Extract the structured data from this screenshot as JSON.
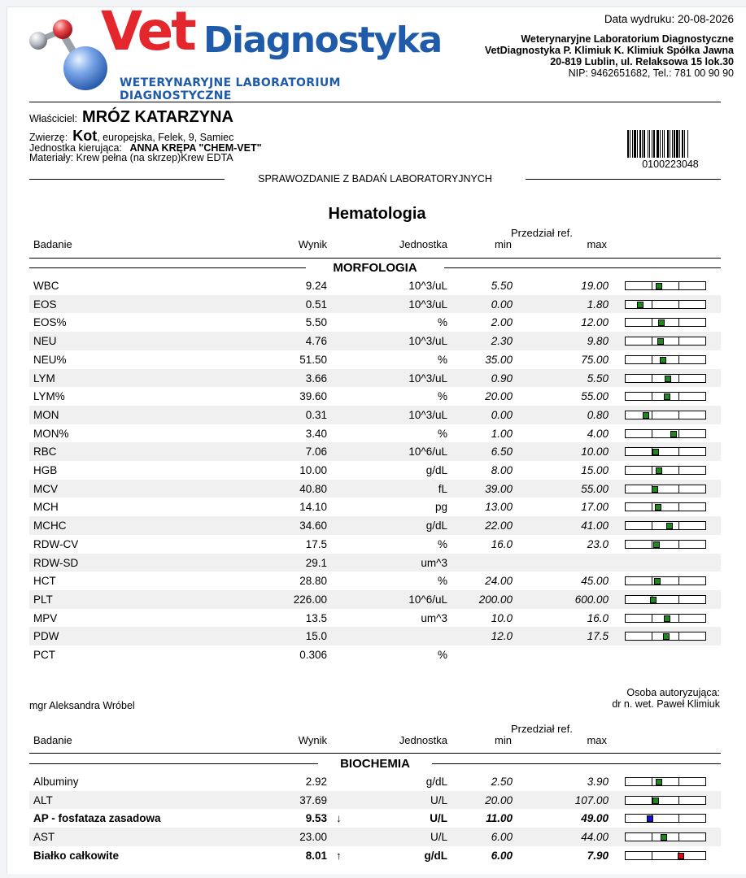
{
  "header": {
    "logo_vet": "Vet",
    "logo_diag": "Diagnostyka",
    "logo_sub": "WETERYNARYJNE LABORATORIUM DIAGNOSTYCZNE",
    "print_date": "Data wydruku: 20-08-2026",
    "lab_line1": "Weterynaryjne Laboratorium Diagnostyczne",
    "lab_line2": "VetDiagnostyka P. Klimiuk K. Klimiuk Spółka Jawna",
    "lab_line3": "20-819 Lublin, ul. Relaksowa 15 lok.30",
    "lab_line4": "NIP: 9462651682, Tel.: 781 00 90 90"
  },
  "patient": {
    "owner_label": "Właściciel:",
    "owner_name": "MRÓZ KATARZYNA",
    "animal_label": "Zwierzę:",
    "species": "Kot",
    "animal_details": ", europejska, Felek, 9, Samiec",
    "unit_label": "Jednostka kierująca:",
    "unit_value": "ANNA KRĘPA \"CHEM-VET\"",
    "materials_label": "Materiały:",
    "materials_value": "Krew pełna (na skrzep)Krew EDTA",
    "barcode_number": "0100223048"
  },
  "report_title": "SPRAWOZDANIE Z BADAŃ LABORATORYJNYCH",
  "columns": {
    "badanie": "Badanie",
    "wynik": "Wynik",
    "jednostka": "Jednostka",
    "ref": "Przedział ref.",
    "min": "min",
    "max": "max"
  },
  "hematology": {
    "title": "Hematologia",
    "group": "MORFOLOGIA",
    "rows": [
      {
        "name": "WBC",
        "result": "9.24",
        "arrow": "",
        "unit": "10^3/uL",
        "min": "5.50",
        "max": "19.00",
        "bold": false,
        "marker_pos": 0.42,
        "marker_color": "#1a8a1a"
      },
      {
        "name": "EOS",
        "result": "0.51",
        "arrow": "",
        "unit": "10^3/uL",
        "min": "0.00",
        "max": "1.80",
        "bold": false,
        "marker_pos": 0.18,
        "marker_color": "#1a8a1a"
      },
      {
        "name": "EOS%",
        "result": "5.50",
        "arrow": "",
        "unit": "%",
        "min": "2.00",
        "max": "12.00",
        "bold": false,
        "marker_pos": 0.45,
        "marker_color": "#1a8a1a"
      },
      {
        "name": "NEU",
        "result": "4.76",
        "arrow": "",
        "unit": "10^3/uL",
        "min": "2.30",
        "max": "9.80",
        "bold": false,
        "marker_pos": 0.44,
        "marker_color": "#1a8a1a"
      },
      {
        "name": "NEU%",
        "result": "51.50",
        "arrow": "",
        "unit": "%",
        "min": "35.00",
        "max": "75.00",
        "bold": false,
        "marker_pos": 0.47,
        "marker_color": "#1a8a1a"
      },
      {
        "name": "LYM",
        "result": "3.66",
        "arrow": "",
        "unit": "10^3/uL",
        "min": "0.90",
        "max": "5.50",
        "bold": false,
        "marker_pos": 0.53,
        "marker_color": "#1a8a1a"
      },
      {
        "name": "LYM%",
        "result": "39.60",
        "arrow": "",
        "unit": "%",
        "min": "20.00",
        "max": "55.00",
        "bold": false,
        "marker_pos": 0.52,
        "marker_color": "#1a8a1a"
      },
      {
        "name": "MON",
        "result": "0.31",
        "arrow": "",
        "unit": "10^3/uL",
        "min": "0.00",
        "max": "0.80",
        "bold": false,
        "marker_pos": 0.25,
        "marker_color": "#1a8a1a"
      },
      {
        "name": "MON%",
        "result": "3.40",
        "arrow": "",
        "unit": "%",
        "min": "1.00",
        "max": "4.00",
        "bold": false,
        "marker_pos": 0.6,
        "marker_color": "#1a8a1a"
      },
      {
        "name": "RBC",
        "result": "7.06",
        "arrow": "",
        "unit": "10^6/uL",
        "min": "6.50",
        "max": "10.00",
        "bold": false,
        "marker_pos": 0.38,
        "marker_color": "#1a8a1a"
      },
      {
        "name": "HGB",
        "result": "10.00",
        "arrow": "",
        "unit": "g/dL",
        "min": "8.00",
        "max": "15.00",
        "bold": false,
        "marker_pos": 0.42,
        "marker_color": "#1a8a1a"
      },
      {
        "name": "MCV",
        "result": "40.80",
        "arrow": "",
        "unit": "fL",
        "min": "39.00",
        "max": "55.00",
        "bold": false,
        "marker_pos": 0.37,
        "marker_color": "#1a8a1a"
      },
      {
        "name": "MCH",
        "result": "14.10",
        "arrow": "",
        "unit": "pg",
        "min": "13.00",
        "max": "17.00",
        "bold": false,
        "marker_pos": 0.41,
        "marker_color": "#1a8a1a"
      },
      {
        "name": "MCHC",
        "result": "34.60",
        "arrow": "",
        "unit": "g/dL",
        "min": "22.00",
        "max": "41.00",
        "bold": false,
        "marker_pos": 0.55,
        "marker_color": "#1a8a1a"
      },
      {
        "name": "RDW-CV",
        "result": "17.5",
        "arrow": "",
        "unit": "%",
        "min": "16.0",
        "max": "23.0",
        "bold": false,
        "marker_pos": 0.39,
        "marker_color": "#1a8a1a"
      },
      {
        "name": "RDW-SD",
        "result": "29.1",
        "arrow": "",
        "unit": "um^3",
        "min": "",
        "max": "",
        "bold": false,
        "marker_pos": null,
        "marker_color": ""
      },
      {
        "name": "HCT",
        "result": "28.80",
        "arrow": "",
        "unit": "%",
        "min": "24.00",
        "max": "45.00",
        "bold": false,
        "marker_pos": 0.4,
        "marker_color": "#1a8a1a"
      },
      {
        "name": "PLT",
        "result": "226.00",
        "arrow": "",
        "unit": "10^6/uL",
        "min": "200.00",
        "max": "600.00",
        "bold": false,
        "marker_pos": 0.35,
        "marker_color": "#1a8a1a"
      },
      {
        "name": "MPV",
        "result": "13.5",
        "arrow": "",
        "unit": "um^3",
        "min": "10.0",
        "max": "16.0",
        "bold": false,
        "marker_pos": 0.52,
        "marker_color": "#1a8a1a"
      },
      {
        "name": "PDW",
        "result": "15.0",
        "arrow": "",
        "unit": "",
        "min": "12.0",
        "max": "17.5",
        "bold": false,
        "marker_pos": 0.51,
        "marker_color": "#1a8a1a"
      },
      {
        "name": "PCT",
        "result": "0.306",
        "arrow": "",
        "unit": "%",
        "min": "",
        "max": "",
        "bold": false,
        "marker_pos": null,
        "marker_color": ""
      }
    ]
  },
  "signatures": {
    "left": "mgr Aleksandra Wróbel",
    "right_label": "Osoba autoryzująca:",
    "right_name": "dr n. wet. Paweł Klimiuk"
  },
  "biochemistry": {
    "group": "BIOCHEMIA",
    "rows": [
      {
        "name": "Albuminy",
        "result": "2.92",
        "arrow": "",
        "unit": "g/dL",
        "min": "2.50",
        "max": "3.90",
        "bold": false,
        "marker_pos": 0.42,
        "marker_color": "#1a8a1a"
      },
      {
        "name": "ALT",
        "result": "37.69",
        "arrow": "",
        "unit": "U/L",
        "min": "20.00",
        "max": "107.00",
        "bold": false,
        "marker_pos": 0.38,
        "marker_color": "#1a8a1a"
      },
      {
        "name": "AP - fosfataza zasadowa",
        "result": "9.53",
        "arrow": "↓",
        "unit": "U/L",
        "min": "11.00",
        "max": "49.00",
        "bold": true,
        "marker_pos": 0.31,
        "marker_color": "#1010d0"
      },
      {
        "name": "AST",
        "result": "23.00",
        "arrow": "",
        "unit": "U/L",
        "min": "6.00",
        "max": "44.00",
        "bold": false,
        "marker_pos": 0.48,
        "marker_color": "#1a8a1a"
      },
      {
        "name": "Białko całkowite",
        "result": "8.01",
        "arrow": "↑",
        "unit": "g/dL",
        "min": "6.00",
        "max": "7.90",
        "bold": true,
        "marker_pos": 0.69,
        "marker_color": "#d01010"
      }
    ]
  },
  "colors": {
    "normal": "#1a8a1a",
    "low": "#1010d0",
    "high": "#d01010",
    "logo_red": "#e4262d",
    "logo_blue": "#1f5ba8"
  }
}
